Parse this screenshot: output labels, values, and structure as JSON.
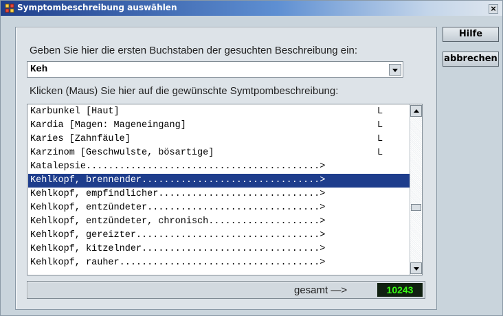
{
  "window": {
    "title": "Symptombeschreibung auswählen",
    "close_label": "×"
  },
  "buttons": {
    "help": "Hilfe",
    "cancel": "abbrechen"
  },
  "search": {
    "prompt": "Geben Sie hier die ersten Buchstaben der gesuchten Beschreibung ein:",
    "value": "Keh"
  },
  "list": {
    "prompt": "Klicken (Maus) Sie hier auf die gewünschte Symtpombeschreibung:",
    "selected_index": 5,
    "items": [
      {
        "name": "Karbunkel [Haut]",
        "code": "L"
      },
      {
        "name": "Kardia [Magen: Mageneingang]",
        "code": "L"
      },
      {
        "name": "Karies [Zahnfäule]",
        "code": "L"
      },
      {
        "name": "Karzinom [Geschwulste, bösartige]",
        "code": "L"
      },
      {
        "name": "Katalepsie..........................................>",
        "code": ""
      },
      {
        "name": "Kehlkopf, brennender................................>",
        "code": ""
      },
      {
        "name": "Kehlkopf, empfindlicher.............................>",
        "code": ""
      },
      {
        "name": "Kehlkopf, entzündeter...............................>",
        "code": ""
      },
      {
        "name": "Kehlkopf, entzündeter, chronisch....................>",
        "code": ""
      },
      {
        "name": "Kehlkopf, gereizter.................................>",
        "code": ""
      },
      {
        "name": "Kehlkopf, kitzelnder................................>",
        "code": ""
      },
      {
        "name": "Kehlkopf, rauher....................................>",
        "code": ""
      }
    ]
  },
  "status": {
    "total_label": "gesamt —>",
    "total_value": "10243"
  },
  "colors": {
    "selection": "#1e3d8c",
    "counter_text": "#39ff14",
    "counter_bg": "#102010"
  }
}
